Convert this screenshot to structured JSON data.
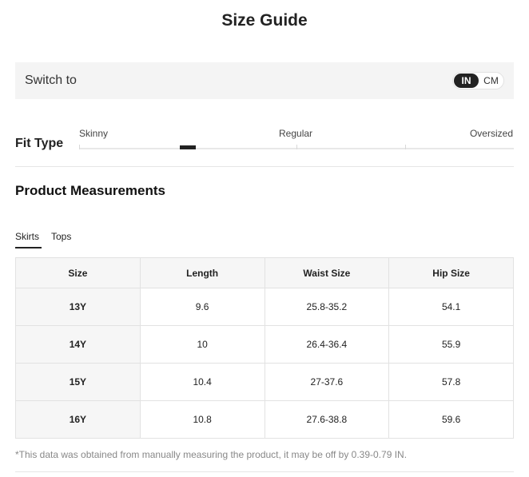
{
  "title": "Size Guide",
  "switch": {
    "label": "Switch to",
    "options": [
      "IN",
      "CM"
    ],
    "selected": "IN"
  },
  "fit": {
    "label": "Fit Type",
    "scale": [
      "Skinny",
      "Regular",
      "Oversized"
    ],
    "level": 0.25
  },
  "section_title": "Product Measurements",
  "tabs": [
    {
      "label": "Skirts",
      "active": true
    },
    {
      "label": "Tops",
      "active": false
    }
  ],
  "table": {
    "headers": [
      "Size",
      "Length",
      "Waist Size",
      "Hip Size"
    ],
    "rows": [
      [
        "13Y",
        "9.6",
        "25.8-35.2",
        "54.1"
      ],
      [
        "14Y",
        "10",
        "26.4-36.4",
        "55.9"
      ],
      [
        "15Y",
        "10.4",
        "27-37.6",
        "57.8"
      ],
      [
        "16Y",
        "10.8",
        "27.6-38.8",
        "59.6"
      ]
    ]
  },
  "footnote": "*This data was obtained from manually measuring the product, it may be off by 0.39-0.79 IN.",
  "colors": {
    "accent": "#222222",
    "panel": "#f4f4f4",
    "border": "#e2e2e2",
    "muted_text": "#888888"
  }
}
